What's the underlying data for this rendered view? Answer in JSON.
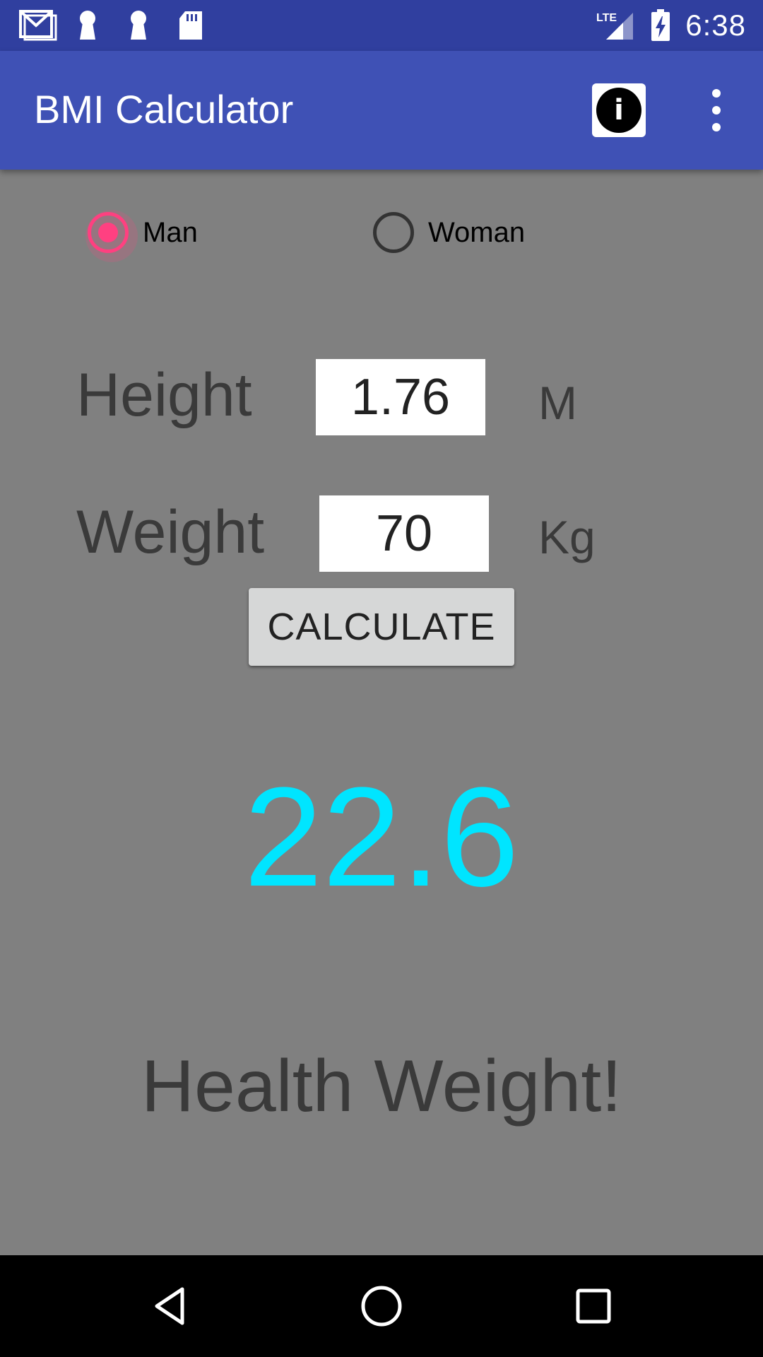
{
  "status_bar": {
    "time": "6:38",
    "network": "LTE",
    "icons": [
      "gmail-icon",
      "keyhole-icon",
      "keyhole-icon",
      "sd-card-icon",
      "signal-icon",
      "battery-charging-icon"
    ]
  },
  "app_bar": {
    "title": "BMI Calculator",
    "info_icon": "i",
    "overflow_icon": "more-vert-icon"
  },
  "gender": {
    "options": [
      {
        "label": "Man",
        "checked": true
      },
      {
        "label": "Woman",
        "checked": false
      }
    ]
  },
  "form": {
    "height_label": "Height",
    "height_value": "1.76",
    "height_unit": "M",
    "weight_label": "Weight",
    "weight_value": "70",
    "weight_unit": "Kg",
    "calculate_label": "CALCULATE"
  },
  "result": {
    "bmi": "22.6",
    "message": "Health Weight!"
  },
  "colors": {
    "status_bar": "#303F9F",
    "app_bar": "#3F51B5",
    "background": "#808080",
    "accent": "#FF4081",
    "bmi_value": "#00E5FF"
  },
  "nav_bar": {
    "icons": [
      "back-icon",
      "home-icon",
      "recents-icon"
    ]
  }
}
